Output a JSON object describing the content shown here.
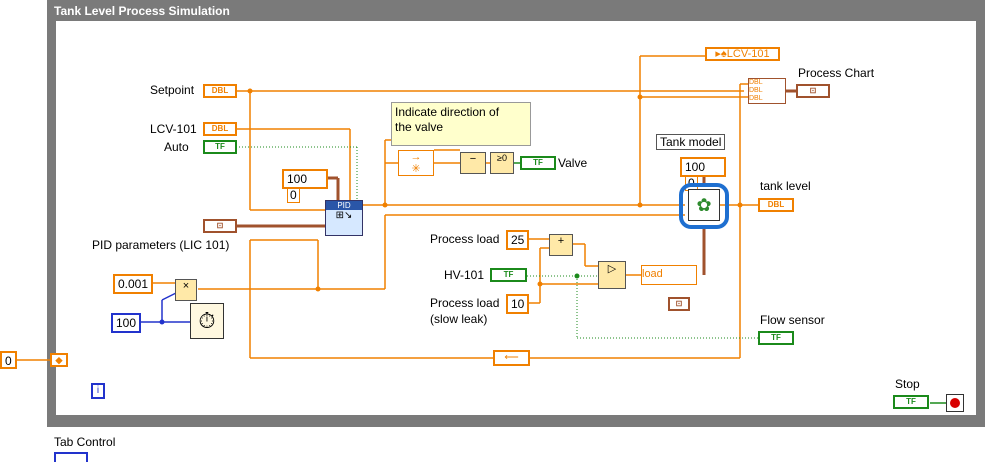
{
  "frame": {
    "title": "Tank Level Process Simulation"
  },
  "outside": {
    "iteration_value": "0",
    "tab_label": "Tab Control"
  },
  "labels": {
    "setpoint": "Setpoint",
    "lcv101": "LCV-101",
    "auto": "Auto",
    "pid_params": "PID parameters (LIC 101)",
    "process_chart": "Process Chart",
    "tank_level": "tank level",
    "tank_model": "Tank model",
    "process_load": "Process load",
    "hv101": "HV-101",
    "process_load_slow": "Process load",
    "slow_leak": "(slow leak)",
    "flow_sensor": "Flow sensor",
    "valve": "Valve",
    "stop": "Stop",
    "local_lcv": "LCV-101",
    "load_node": "load"
  },
  "comment": {
    "line1": "Indicate direction of",
    "line2": "the valve"
  },
  "constants": {
    "pid_range_a": "100",
    "pid_range_b": "0",
    "tank_range_a": "100",
    "tank_range_b": "0",
    "dt": "0.001",
    "wait_ms": "100",
    "process_load": "25",
    "slow_leak": "10"
  },
  "terminals": {
    "dbl": "DBL",
    "tf": "TF",
    "cluster": "⊡",
    "pid": "PID",
    "compare": "≥0",
    "info": "i"
  },
  "colors": {
    "float": "#f08000",
    "bool": "#1b8a1b",
    "int": "#2233cc",
    "cluster": "#a0522d",
    "highlight": "#1e6fd0"
  }
}
